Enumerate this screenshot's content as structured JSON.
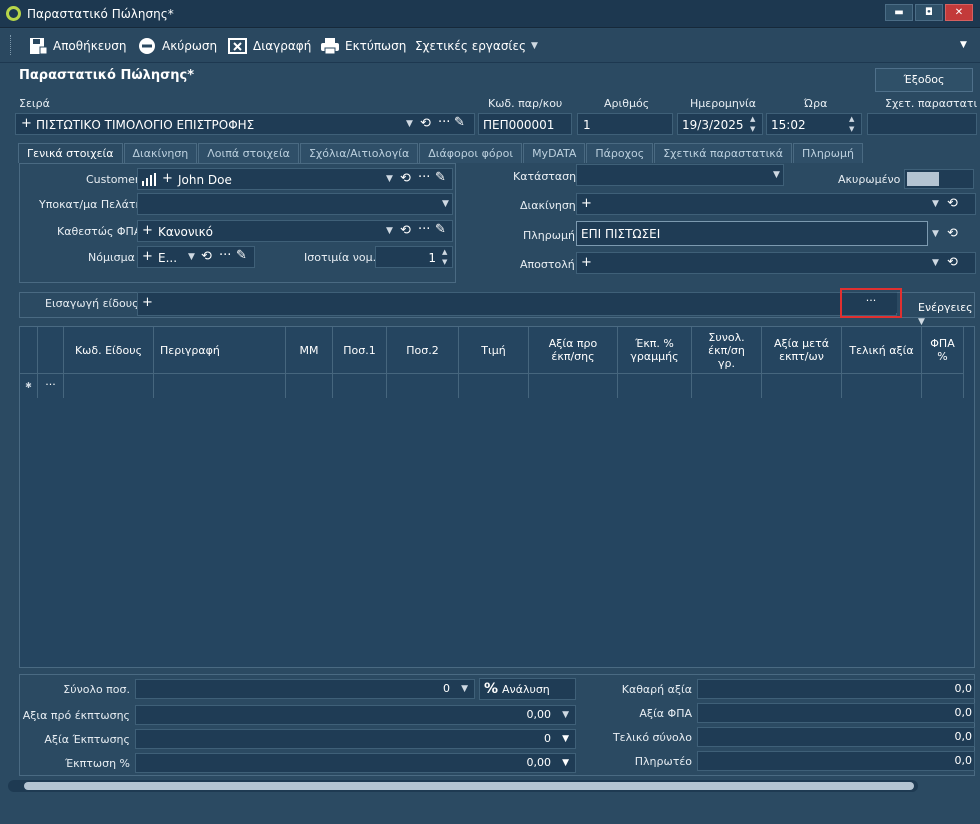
{
  "window": {
    "title": "Παραστατικό Πώλησης*",
    "min": "▬",
    "max": "◘",
    "close": "✕"
  },
  "toolbar": {
    "save": "Αποθήκευση",
    "cancel": "Ακύρωση",
    "delete": "Διαγραφή",
    "print": "Εκτύπωση",
    "related": "Σχετικές εργασίες"
  },
  "header": {
    "title": "Παραστατικό Πώλησης*",
    "exit": "Έξοδος"
  },
  "top": {
    "series_label": "Σειρά",
    "series_value": "ΠΙΣΤΩΤΙΚΟ ΤΙΜΟΛΟΓΙΟ ΕΠΙΣΤΡΟΦΗΣ",
    "code_label": "Κωδ. παρ/κου",
    "code_value": "ΠΕΠ000001",
    "number_label": "Αριθμός",
    "number_value": "1",
    "date_label": "Ημερομηνία",
    "date_value": "19/3/2025",
    "time_label": "Ώρα",
    "time_value": "15:02",
    "related_label": "Σχετ. παραστατικ"
  },
  "tabs": [
    "Γενικά στοιχεία",
    "Διακίνηση",
    "Λοιπά στοιχεία",
    "Σχόλια/Αιτιολογία",
    "Διάφοροι φόροι",
    "MyDATA",
    "Πάροχος",
    "Σχετικά παραστατικά",
    "Πληρωμή"
  ],
  "form": {
    "customer_label": "Customer",
    "customer_value": "John Doe",
    "subaccount_label": "Υποκατ/μα Πελάτη",
    "vat_label": "Καθεστώς ΦΠΑ",
    "vat_value": "Κανονικό",
    "currency_label": "Νόμισμα",
    "currency_value": "E...",
    "parity_label": "Ισοτιμία νομ.",
    "parity_value": "1",
    "status_label": "Κατάσταση",
    "cancelled_label": "Ακυρωμένο",
    "shipping_label": "Διακίνηση",
    "payment_label": "Πληρωμή",
    "payment_value": "ΕΠΙ ΠΙΣΤΩΣΕΙ",
    "delivery_label": "Αποστολή"
  },
  "items": {
    "insert_label": "Εισαγωγή είδους",
    "more": "···",
    "actions": "Ενέργειες"
  },
  "grid": {
    "columns": [
      "Κωδ. Είδους",
      "Περιγραφή",
      "ΜΜ",
      "Ποσ.1",
      "Ποσ.2",
      "Τιμή",
      "Αξία προ έκπ/σης",
      "Έκπ. % γραμμής",
      "Συνολ. έκπ/ση γρ.",
      "Αξία μετά εκπτ/ων",
      "Τελική αξία",
      "ΦΠΑ %"
    ],
    "new_row_marker": "✱",
    "new_row_more": "···"
  },
  "totals": {
    "qty_label": "Σύνολο ποσ.",
    "qty_value": "0",
    "vat_analysis": "Ανάλυση ΦΠΑ",
    "pre_discount_label": "Αξια πρό έκπτωσης",
    "pre_discount_value": "0,00",
    "discount_label": "Αξία Έκπτωσης",
    "discount_value": "0",
    "discount_pct_label": "Έκπτωση %",
    "discount_pct_value": "0,00",
    "net_label": "Καθαρή αξία",
    "net_value": "0,0",
    "vat_label": "Αξία ΦΠΑ",
    "vat_value": "0,0",
    "total_label": "Τελικό σύνολο",
    "total_value": "0,0",
    "payable_label": "Πληρωτέο",
    "payable_value": "0,0"
  },
  "colors": {
    "accent": "#b7d64a",
    "highlight": "#e03030",
    "bg": "#2b4a62"
  }
}
